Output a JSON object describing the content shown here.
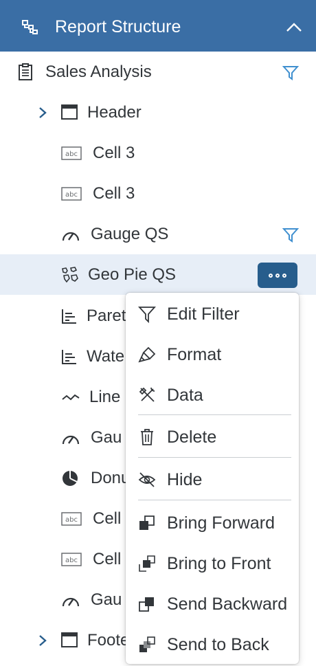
{
  "panel": {
    "title": "Report Structure",
    "header_color": "#3a6ea5"
  },
  "tree": {
    "root_label": "Sales Analysis",
    "header_label": "Header",
    "cell_3a_label": "Cell 3",
    "cell_3b_label": "Cell 3",
    "gauge_qs_label": "Gauge QS",
    "geo_pie_qs_label": "Geo Pie QS",
    "pareto_label": "Paret",
    "waterfall_label": "Wate",
    "line_label": "Line",
    "gauge2_label": "Gau",
    "donut_label": "Donu",
    "cell_c_label": "Cell",
    "cell_d_label": "Cell",
    "gauge3_label": "Gau",
    "footer_label": "Foote",
    "selected_item": "Geo Pie QS"
  },
  "context_menu": {
    "edit_filter": "Edit Filter",
    "format": "Format",
    "data": "Data",
    "delete": "Delete",
    "hide": "Hide",
    "bring_forward": "Bring Forward",
    "bring_to_front": "Bring to Front",
    "send_backward": "Send Backward",
    "send_to_back": "Send to Back"
  },
  "icons": {
    "header": "hierarchy-icon",
    "collapse": "chevron-up-icon",
    "root": "document-icon",
    "filter": "filter-icon",
    "more": "overflow-icon"
  },
  "colors": {
    "accent": "#275d8c",
    "selected_row": "#e7eef7",
    "filter_icon": "#3f8fcf",
    "text": "#32363a"
  }
}
